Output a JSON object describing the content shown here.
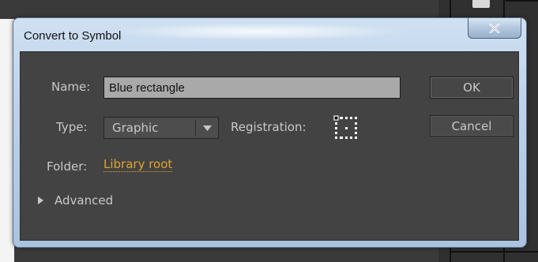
{
  "dialog": {
    "title": "Convert to Symbol",
    "close_icon": "close-x-icon"
  },
  "form": {
    "name_label": "Name:",
    "name_value": "Blue rectangle",
    "type_label": "Type:",
    "type_value": "Graphic",
    "registration_label": "Registration:",
    "registration_selected": "top-left",
    "folder_label": "Folder:",
    "folder_value": "Library root",
    "advanced_label": "Advanced"
  },
  "buttons": {
    "ok_label": "OK",
    "cancel_label": "Cancel"
  },
  "colors": {
    "panel": "#434343",
    "text": "#c9c9c9",
    "link": "#e0a430",
    "input_bg": "#a9a9a9"
  }
}
